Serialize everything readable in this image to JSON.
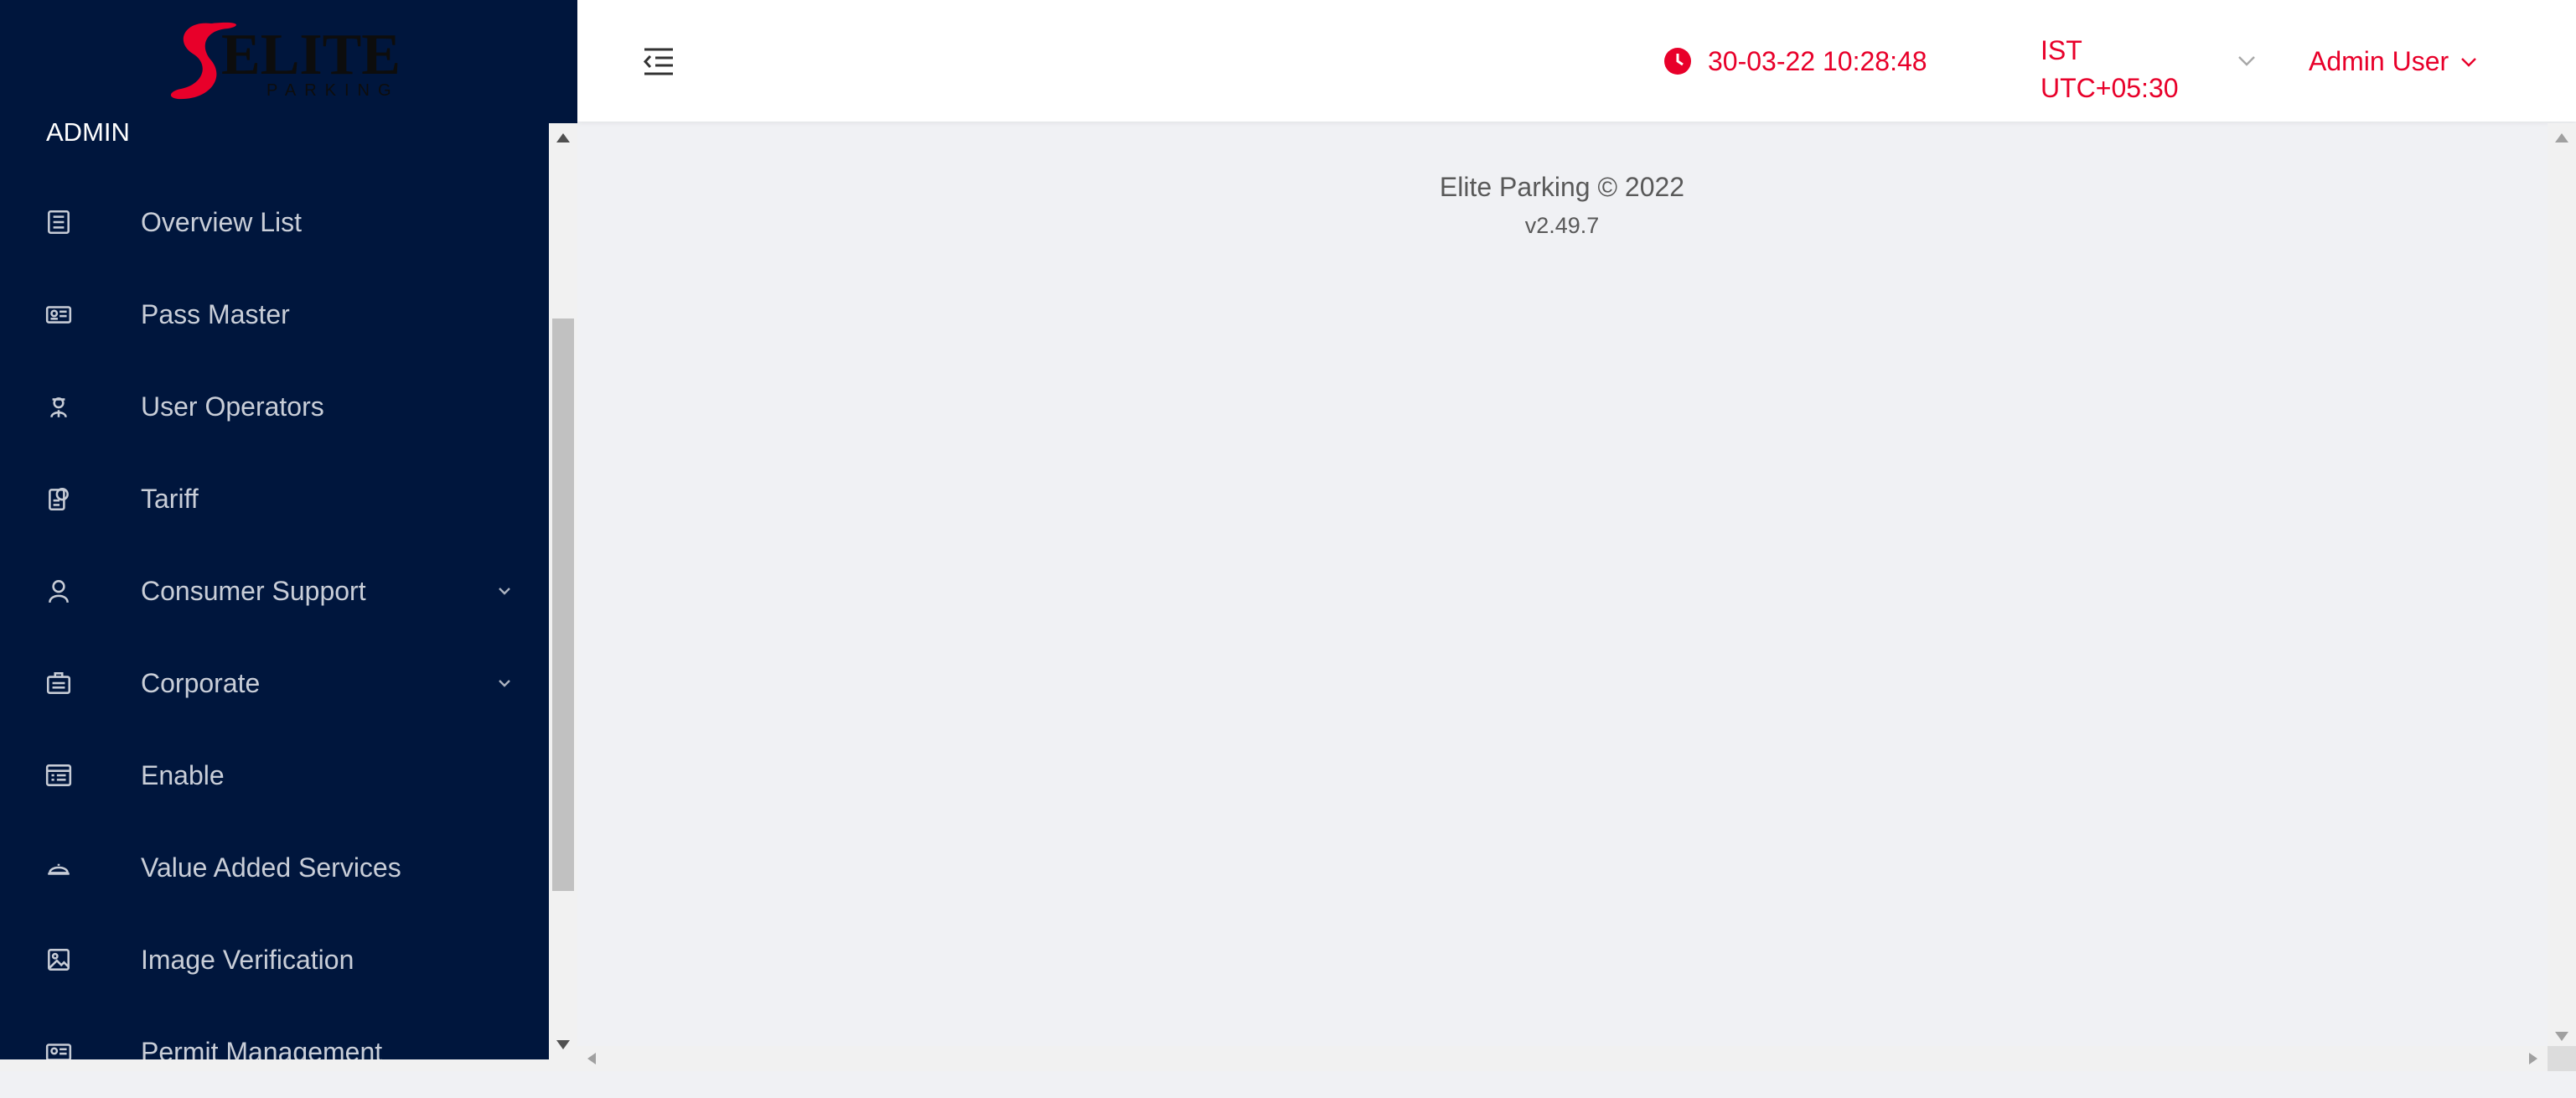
{
  "brand": {
    "logo_text": "ELITE",
    "logo_subtext": "PARKING"
  },
  "sidebar": {
    "section_title": "ADMIN",
    "items": [
      {
        "label": "Overview List",
        "icon": "list-icon",
        "expandable": false
      },
      {
        "label": "Pass Master",
        "icon": "id-card-icon",
        "expandable": false
      },
      {
        "label": "User Operators",
        "icon": "operator-icon",
        "expandable": false
      },
      {
        "label": "Tariff",
        "icon": "tariff-icon",
        "expandable": false
      },
      {
        "label": "Consumer Support",
        "icon": "user-icon",
        "expandable": true
      },
      {
        "label": "Corporate",
        "icon": "briefcase-icon",
        "expandable": true
      },
      {
        "label": "Enable",
        "icon": "form-icon",
        "expandable": false
      },
      {
        "label": "Value Added Services",
        "icon": "service-bell-icon",
        "expandable": false
      },
      {
        "label": "Image Verification",
        "icon": "image-icon",
        "expandable": false
      },
      {
        "label": "Permit Management",
        "icon": "id-card-icon",
        "expandable": false
      }
    ]
  },
  "header": {
    "datetime": "30-03-22 10:28:48",
    "timezone_line1": "IST",
    "timezone_line2": "UTC+05:30",
    "user_name": "Admin User"
  },
  "footer": {
    "copyright": "Elite Parking © 2022",
    "version": "v2.49.7"
  },
  "colors": {
    "sidebar_bg": "#00163d",
    "accent": "#e8002a",
    "content_bg": "#f0f1f4"
  }
}
